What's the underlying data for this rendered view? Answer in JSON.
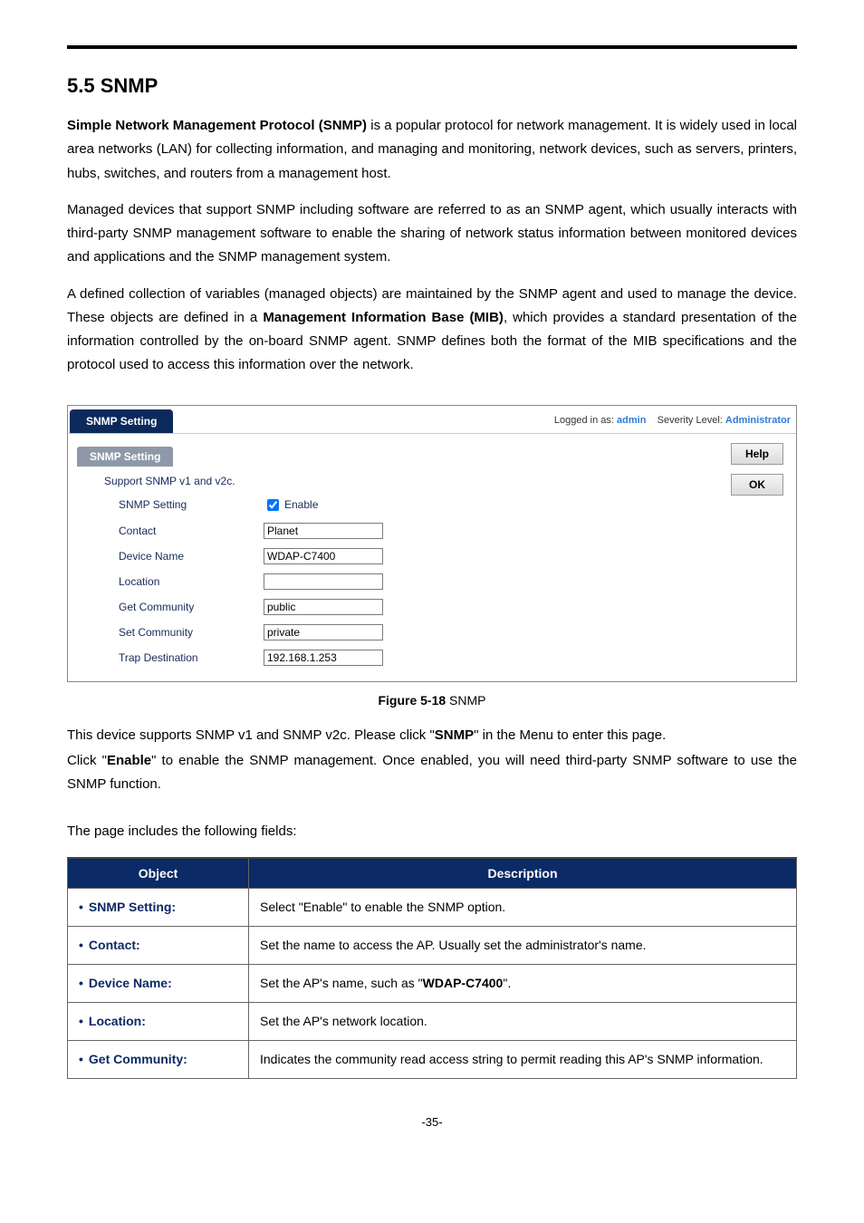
{
  "section_heading": "5.5  SNMP",
  "para1_lead_bold": "Simple Network Management Protocol (SNMP)",
  "para1_rest": " is a popular protocol for network management. It is widely used in local area networks (LAN) for collecting information, and managing and monitoring, network devices, such as servers, printers, hubs, switches, and routers from a management host.",
  "para2": "Managed devices that support SNMP including software are referred to as an SNMP agent, which usually interacts with third-party SNMP management software to enable the sharing of network status information between monitored devices and applications and the SNMP management system.",
  "para3_a": "A defined collection of variables (managed objects) are maintained by the SNMP agent and used to manage the device. These objects are defined in a ",
  "para3_bold": "Management Information Base (MIB)",
  "para3_b": ", which provides a standard presentation of the information controlled by the on-board SNMP agent. SNMP defines both the format of the MIB specifications and the protocol used to access this information over the network.",
  "shot": {
    "tab_title": "SNMP Setting",
    "logged_label": "Logged in as: ",
    "logged_user": "admin",
    "sev_label": "Severity Level: ",
    "sev_val": "Administrator",
    "section_tab": "SNMP Setting",
    "support_note": "Support SNMP v1 and v2c.",
    "rows": {
      "snmp_setting": "SNMP Setting",
      "enable_label": "Enable",
      "contact": "Contact",
      "contact_val": "Planet",
      "device_name": "Device Name",
      "device_name_val": "WDAP-C7400",
      "location": "Location",
      "location_val": "",
      "get_comm": "Get Community",
      "get_comm_val": "public",
      "set_comm": "Set Community",
      "set_comm_val": "private",
      "trap": "Trap Destination",
      "trap_val": "192.168.1.253"
    },
    "help_btn": "Help",
    "ok_btn": "OK"
  },
  "figure_caption_bold": "Figure 5-18",
  "figure_caption_rest": " SNMP",
  "post1_a": "This device supports SNMP v1 and SNMP v2c. Please click \"",
  "post1_bold": "SNMP",
  "post1_b": "\" in the Menu to enter this page.",
  "post2_a": "Click \"",
  "post2_bold": "Enable",
  "post2_b": "\" to enable the SNMP management. Once enabled, you will need third-party SNMP software to use the SNMP function.",
  "fields_intro": "The page includes the following fields:",
  "table": {
    "h_object": "Object",
    "h_desc": "Description",
    "rows": [
      {
        "obj": "SNMP Setting:",
        "desc_a": "Select \"Enable\" to enable the SNMP option.",
        "bold": "",
        "desc_b": ""
      },
      {
        "obj": "Contact:",
        "desc_a": "Set the name to access the AP. Usually set the administrator's name.",
        "bold": "",
        "desc_b": ""
      },
      {
        "obj": "Device Name:",
        "desc_a": "Set the AP's name, such as \"",
        "bold": "WDAP-C7400",
        "desc_b": "\"."
      },
      {
        "obj": "Location:",
        "desc_a": "Set the AP's network location.",
        "bold": "",
        "desc_b": ""
      },
      {
        "obj": "Get Community:",
        "desc_a": "Indicates the community read access string to permit reading this AP's SNMP information.",
        "bold": "",
        "desc_b": ""
      }
    ]
  },
  "page_number": "-35-"
}
